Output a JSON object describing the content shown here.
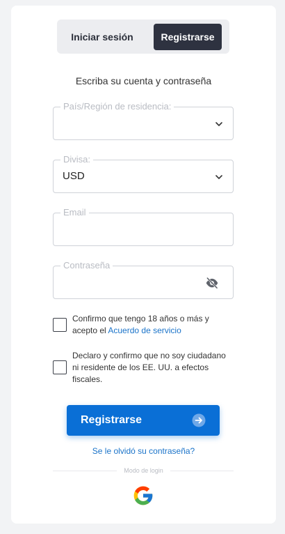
{
  "tabs": {
    "login_label": "Iniciar sesión",
    "register_label": "Registrarse"
  },
  "form": {
    "subtitle": "Escriba su cuenta y contraseña",
    "country": {
      "label": "País/Región de residencia:",
      "value": ""
    },
    "currency": {
      "label": "Divisa:",
      "value": "USD"
    },
    "email": {
      "label": "Email",
      "value": ""
    },
    "password": {
      "label": "Contraseña",
      "value": ""
    },
    "age_check": {
      "text": "Confirmo que tengo 18 años o más y acepto el ",
      "link": "Acuerdo de servicio"
    },
    "us_check": {
      "text": "Declaro y confirmo que no soy ciudadano ni residente de los EE. UU. a efectos fiscales."
    },
    "submit_label": "Registrarse",
    "forgot_link": "Se le olvidó su contraseña?",
    "login_mode_label": "Modo de login"
  },
  "icons": {
    "select": "chevron-down-icon",
    "password_toggle": "eye-off-icon",
    "submit": "arrow-right-circle-icon",
    "social": "google-icon"
  },
  "colors": {
    "primary": "#0a6fd6",
    "tab_active": "#2e3240",
    "link": "#1a73c9"
  }
}
